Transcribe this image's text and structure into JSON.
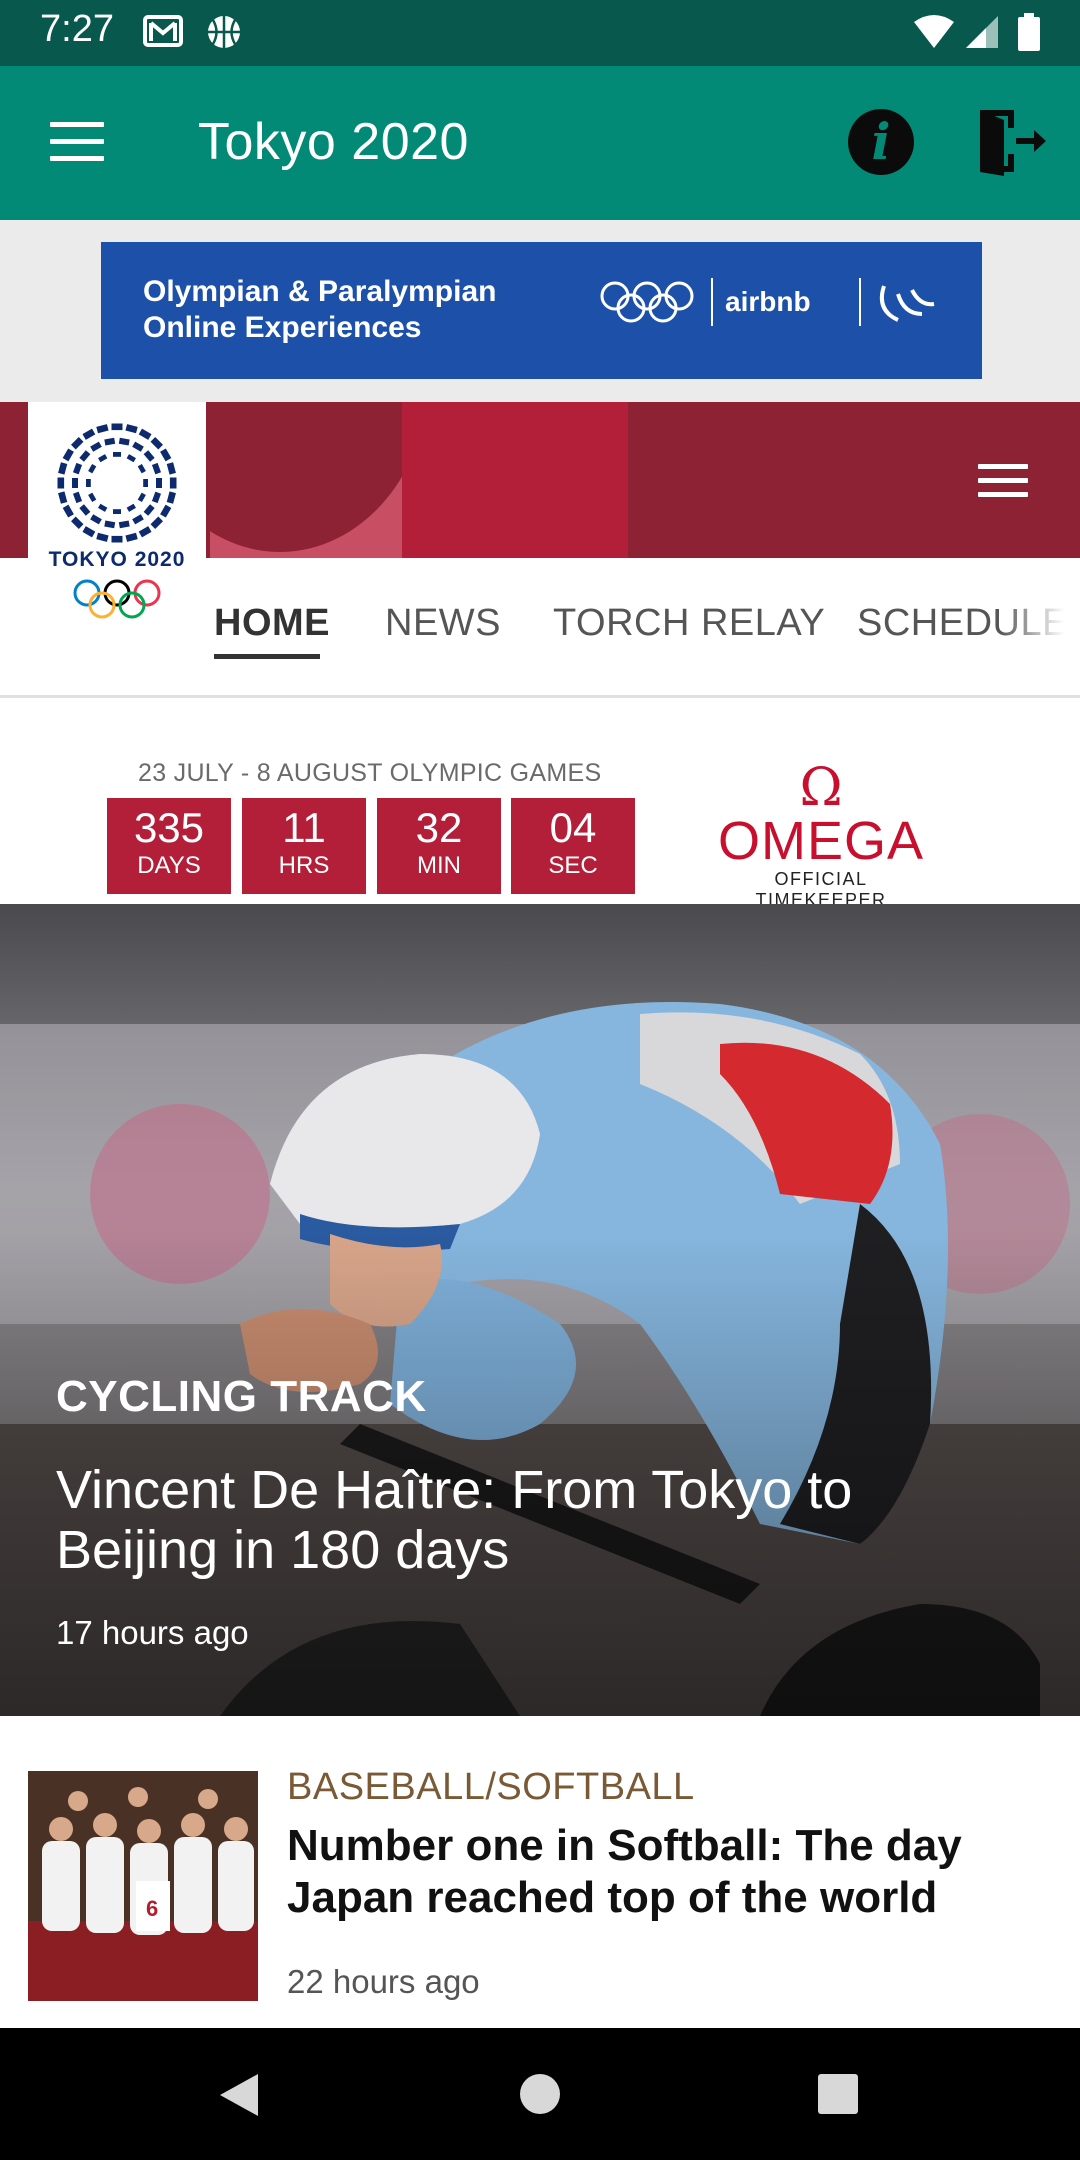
{
  "status_bar": {
    "time": "7:27",
    "icons": [
      "gmail-icon",
      "sports-ball-icon",
      "wifi-icon",
      "signal-icon",
      "battery-icon"
    ]
  },
  "app_bar": {
    "title": "Tokyo 2020",
    "icons": [
      "menu-icon",
      "info-icon",
      "logout-icon"
    ],
    "colors": {
      "background": "#038a77",
      "status": "#08584d"
    }
  },
  "ad_banner": {
    "text_line1": "Olympian & Paralympian",
    "text_line2": "Online Experiences",
    "brand": "airbnb",
    "background": "#1d50a8"
  },
  "site_header": {
    "logo_text": "TOKYO 2020",
    "colors": {
      "maroon": "#8c2233",
      "pink": "#c84e63",
      "red": "#b31f38"
    },
    "tabs": [
      {
        "label": "HOME",
        "active": true
      },
      {
        "label": "NEWS",
        "active": false
      },
      {
        "label": "TORCH RELAY",
        "active": false
      },
      {
        "label": "SCHEDULE",
        "active": false
      }
    ]
  },
  "countdown": {
    "caption": "23 JULY - 8 AUGUST OLYMPIC GAMES",
    "units": [
      {
        "value": "335",
        "label": "DAYS"
      },
      {
        "value": "11",
        "label": "HRS"
      },
      {
        "value": "32",
        "label": "MIN"
      },
      {
        "value": "04",
        "label": "SEC"
      }
    ],
    "sponsor": {
      "symbol": "Ω",
      "name": "OMEGA",
      "subtitle": "OFFICIAL TIMEKEEPER"
    }
  },
  "hero": {
    "sport": "CYCLING TRACK",
    "title": "Vincent De Haître: From Tokyo to Beijing in 180 days",
    "time": "17 hours ago"
  },
  "news": [
    {
      "sport": "BASEBALL/SOFTBALL",
      "title": "Number one in Softball: The day Japan reached top of the world",
      "time": "22 hours ago"
    }
  ],
  "nav_bar": {
    "icons": [
      "back-icon",
      "home-icon",
      "recents-icon"
    ]
  }
}
